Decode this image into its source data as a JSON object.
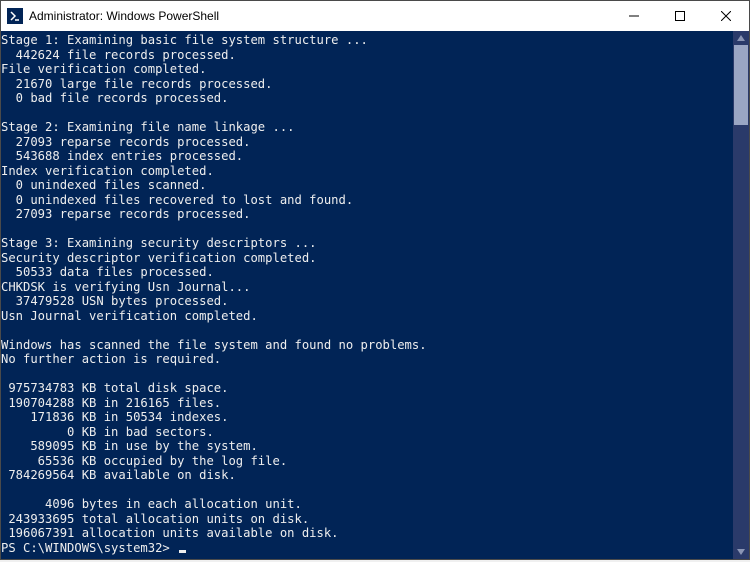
{
  "titlebar": {
    "title": "Administrator: Windows PowerShell"
  },
  "terminal": {
    "lines": [
      "Stage 1: Examining basic file system structure ...",
      "  442624 file records processed.",
      "File verification completed.",
      "  21670 large file records processed.",
      "  0 bad file records processed.",
      "",
      "Stage 2: Examining file name linkage ...",
      "  27093 reparse records processed.",
      "  543688 index entries processed.",
      "Index verification completed.",
      "  0 unindexed files scanned.",
      "  0 unindexed files recovered to lost and found.",
      "  27093 reparse records processed.",
      "",
      "Stage 3: Examining security descriptors ...",
      "Security descriptor verification completed.",
      "  50533 data files processed.",
      "CHKDSK is verifying Usn Journal...",
      "  37479528 USN bytes processed.",
      "Usn Journal verification completed.",
      "",
      "Windows has scanned the file system and found no problems.",
      "No further action is required.",
      "",
      " 975734783 KB total disk space.",
      " 190704288 KB in 216165 files.",
      "    171836 KB in 50534 indexes.",
      "         0 KB in bad sectors.",
      "    589095 KB in use by the system.",
      "     65536 KB occupied by the log file.",
      " 784269564 KB available on disk.",
      "",
      "      4096 bytes in each allocation unit.",
      " 243933695 total allocation units on disk.",
      " 196067391 allocation units available on disk."
    ],
    "prompt": "PS C:\\WINDOWS\\system32> "
  }
}
